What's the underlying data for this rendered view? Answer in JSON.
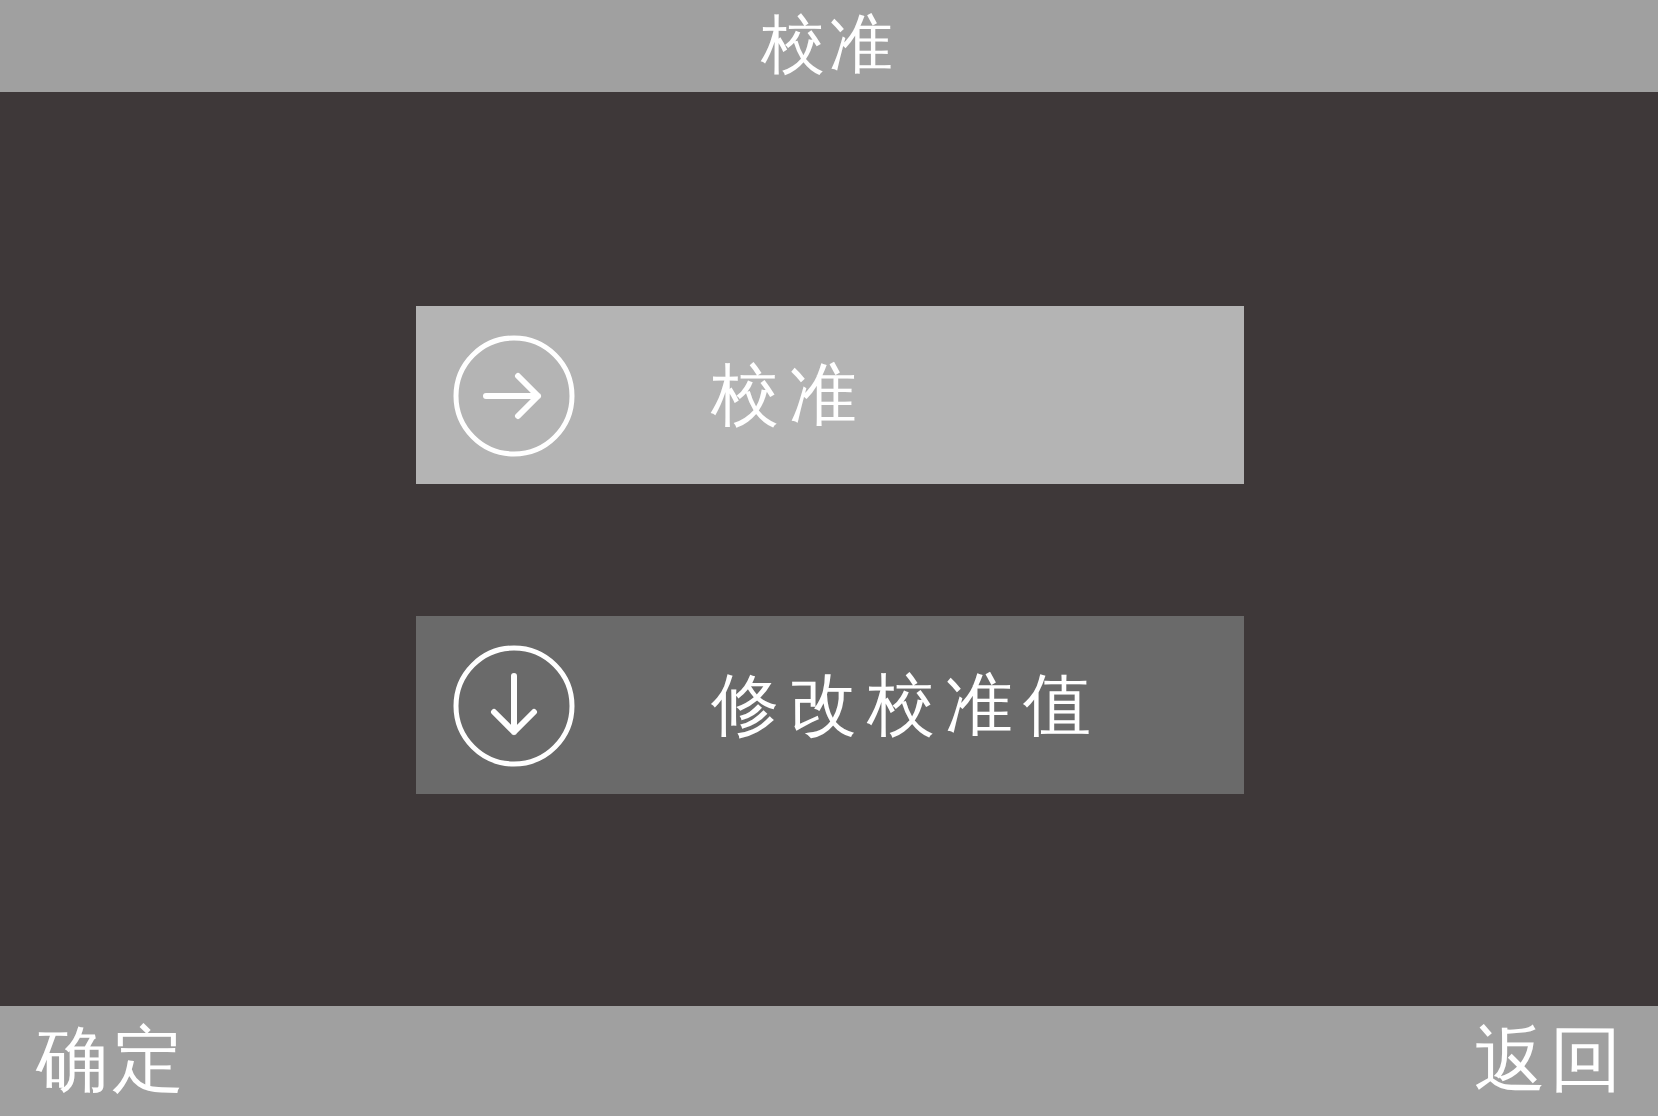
{
  "title": "校准",
  "menu": [
    {
      "label": "校准",
      "kind": "next",
      "selected": true
    },
    {
      "label": "修改校准值",
      "kind": "down",
      "selected": false
    }
  ],
  "softkeys": {
    "left": "确定",
    "right": "返回"
  }
}
